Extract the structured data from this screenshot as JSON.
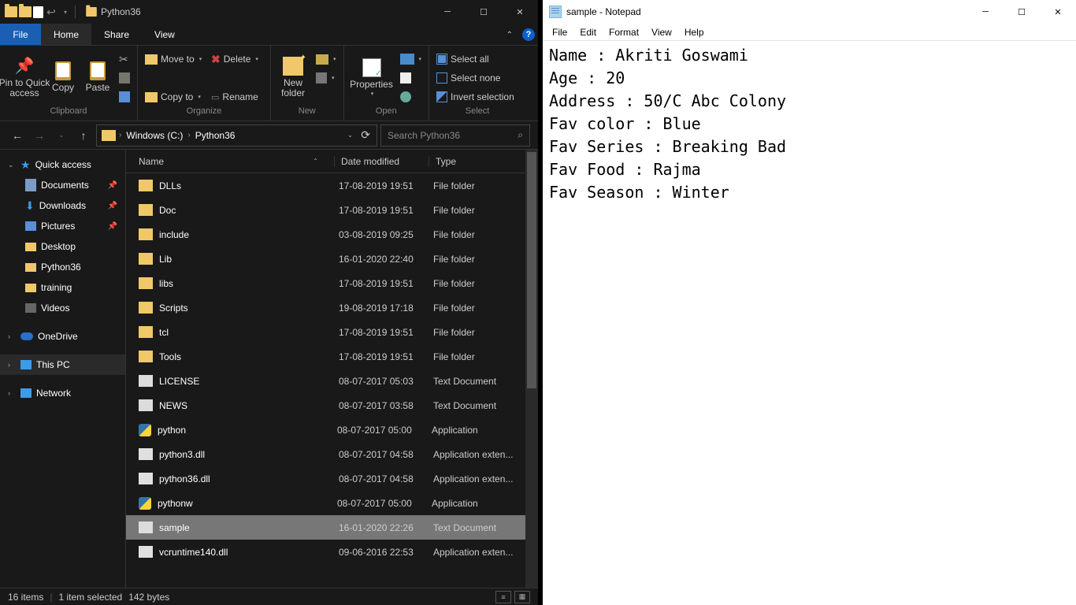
{
  "explorer": {
    "title": "Python36",
    "menu": {
      "file": "File",
      "home": "Home",
      "share": "Share",
      "view": "View"
    },
    "ribbon": {
      "clipboard": {
        "label": "Clipboard",
        "pin": "Pin to Quick\naccess",
        "copy": "Copy",
        "paste": "Paste"
      },
      "organize": {
        "label": "Organize",
        "moveto": "Move to",
        "copyto": "Copy to",
        "delete": "Delete",
        "rename": "Rename"
      },
      "new": {
        "label": "New",
        "folder": "New\nfolder"
      },
      "open": {
        "label": "Open",
        "properties": "Properties",
        "open": "Open",
        "edit": "Edit",
        "history": "History"
      },
      "select": {
        "label": "Select",
        "all": "Select all",
        "none": "Select none",
        "invert": "Invert selection"
      }
    },
    "breadcrumb": {
      "root": "Windows (C:)",
      "current": "Python36"
    },
    "search_placeholder": "Search Python36",
    "sidebar": {
      "quick": "Quick access",
      "docs": "Documents",
      "downloads": "Downloads",
      "pictures": "Pictures",
      "desktop": "Desktop",
      "python36": "Python36",
      "training": "training",
      "videos": "Videos",
      "onedrive": "OneDrive",
      "thispc": "This PC",
      "network": "Network"
    },
    "columns": {
      "name": "Name",
      "date": "Date modified",
      "type": "Type"
    },
    "files": [
      {
        "name": "DLLs",
        "date": "17-08-2019 19:51",
        "type": "File folder",
        "icon": "folder"
      },
      {
        "name": "Doc",
        "date": "17-08-2019 19:51",
        "type": "File folder",
        "icon": "folder"
      },
      {
        "name": "include",
        "date": "03-08-2019 09:25",
        "type": "File folder",
        "icon": "folder"
      },
      {
        "name": "Lib",
        "date": "16-01-2020 22:40",
        "type": "File folder",
        "icon": "folder"
      },
      {
        "name": "libs",
        "date": "17-08-2019 19:51",
        "type": "File folder",
        "icon": "folder"
      },
      {
        "name": "Scripts",
        "date": "19-08-2019 17:18",
        "type": "File folder",
        "icon": "folder"
      },
      {
        "name": "tcl",
        "date": "17-08-2019 19:51",
        "type": "File folder",
        "icon": "folder"
      },
      {
        "name": "Tools",
        "date": "17-08-2019 19:51",
        "type": "File folder",
        "icon": "folder"
      },
      {
        "name": "LICENSE",
        "date": "08-07-2017 05:03",
        "type": "Text Document",
        "icon": "txt"
      },
      {
        "name": "NEWS",
        "date": "08-07-2017 03:58",
        "type": "Text Document",
        "icon": "txt"
      },
      {
        "name": "python",
        "date": "08-07-2017 05:00",
        "type": "Application",
        "icon": "py"
      },
      {
        "name": "python3.dll",
        "date": "08-07-2017 04:58",
        "type": "Application exten...",
        "icon": "dll"
      },
      {
        "name": "python36.dll",
        "date": "08-07-2017 04:58",
        "type": "Application exten...",
        "icon": "dll"
      },
      {
        "name": "pythonw",
        "date": "08-07-2017 05:00",
        "type": "Application",
        "icon": "py"
      },
      {
        "name": "sample",
        "date": "16-01-2020 22:26",
        "type": "Text Document",
        "icon": "txt",
        "selected": true
      },
      {
        "name": "vcruntime140.dll",
        "date": "09-06-2016 22:53",
        "type": "Application exten...",
        "icon": "dll"
      }
    ],
    "status": {
      "count": "16 items",
      "sel": "1 item selected",
      "size": "142 bytes"
    }
  },
  "notepad": {
    "title": "sample - Notepad",
    "menu": {
      "file": "File",
      "edit": "Edit",
      "format": "Format",
      "view": "View",
      "help": "Help"
    },
    "lines": [
      "Name : Akriti Goswami",
      "Age : 20",
      "Address : 50/C Abc Colony",
      "Fav color : Blue",
      "Fav Series : Breaking Bad",
      "Fav Food : Rajma",
      "Fav Season : Winter"
    ]
  }
}
